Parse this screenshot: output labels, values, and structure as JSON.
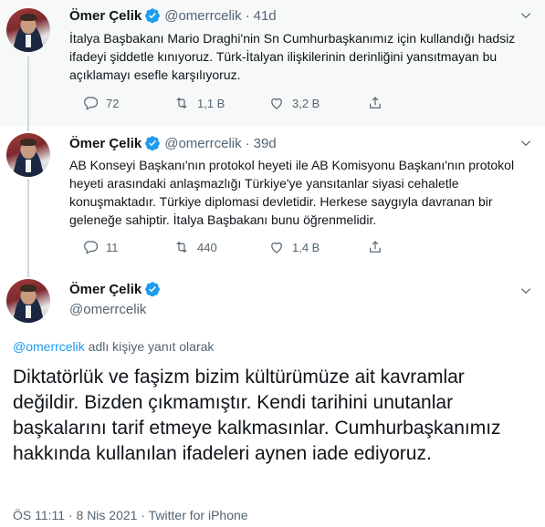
{
  "tweets": [
    {
      "name": "Ömer Çelik",
      "handle": "@omerrcelik",
      "time": "41d",
      "text": "İtalya Başbakanı Mario Draghi'nin Sn Cumhurbaşkanımız için kullandığı hadsiz ifadeyi şiddetle kınıyoruz. Türk-İtalyan ilişkilerinin derinliğini yansıtmayan bu açıklamayı esefle karşılıyoruz.",
      "replies": "72",
      "retweets": "1,1 B",
      "likes": "3,2 B"
    },
    {
      "name": "Ömer Çelik",
      "handle": "@omerrcelik",
      "time": "39d",
      "text": "AB Konseyi Başkanı'nın protokol heyeti ile AB Komisyonu Başkanı'nın protokol heyeti arasındaki anlaşmazlığı Türkiye'ye yansıtanlar siyasi cehaletle konuşmaktadır. Türkiye diplomasi devletidir. Herkese saygıyla davranan bir geleneğe sahiptir. İtalya Başbakanı bunu öğrenmelidir.",
      "replies": "11",
      "retweets": "440",
      "likes": "1,4 B"
    }
  ],
  "main": {
    "name": "Ömer Çelik",
    "handle": "@omerrcelik",
    "reply_mention": "@omerrcelik",
    "reply_suffix": " adlı kişiye yanıt olarak",
    "text": "Diktatörlük ve faşizm bizim kültürümüze ait kavramlar değildir. Bizden çıkmamıştır. Kendi tarihini unutanlar başkalarını tarif etmeye kalkmasınlar. Cumhurbaşkanımız hakkında kullanılan ifadeleri aynen iade ediyoruz.",
    "meta": "ÖS 11:11 · 8 Nis 2021 · Twitter for iPhone"
  },
  "colors": {
    "accent": "#1d9bf0",
    "secondary_text": "#536471",
    "primary_text": "#0f1419"
  }
}
